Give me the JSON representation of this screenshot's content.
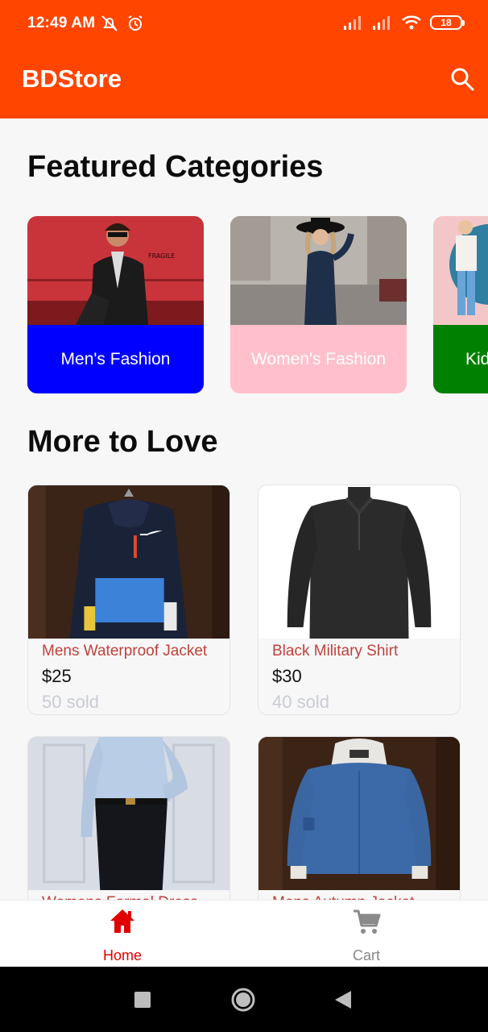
{
  "status_bar": {
    "time": "12:49 AM",
    "battery": "18",
    "icons": [
      "mute-off-icon",
      "alarm-icon",
      "signal-icon",
      "signal-icon",
      "wifi-icon",
      "battery-icon"
    ]
  },
  "app_bar": {
    "title": "BDStore",
    "search_icon": "search-icon"
  },
  "featured": {
    "title": "Featured Categories",
    "categories": [
      {
        "label": "Men's Fashion",
        "color": "#0000ff"
      },
      {
        "label": "Women's Fashion",
        "color": "#ffc0cb"
      },
      {
        "label": "Kids Fashion",
        "color": "#008000"
      }
    ]
  },
  "more": {
    "title": "More to Love",
    "products": [
      {
        "name": "Mens Waterproof Jacket",
        "price": "$25",
        "sold": "50 sold"
      },
      {
        "name": "Black Military Shirt",
        "price": "$30",
        "sold": "40 sold"
      },
      {
        "name": "Womens Formal Dress",
        "price": "",
        "sold": ""
      },
      {
        "name": "Mens Autumn Jacket",
        "price": "",
        "sold": ""
      }
    ]
  },
  "bottom_nav": {
    "items": [
      {
        "label": "Home",
        "icon": "home-icon",
        "active": true,
        "color": "#e00000"
      },
      {
        "label": "Cart",
        "icon": "cart-icon",
        "active": false,
        "color": "#888888"
      }
    ]
  },
  "colors": {
    "accent": "#ff4500",
    "price_name": "#c1413a"
  }
}
